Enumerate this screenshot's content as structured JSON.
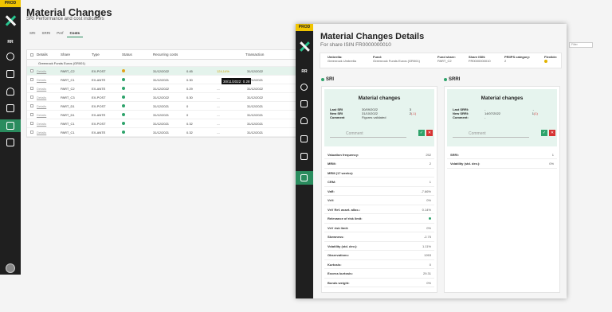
{
  "app": {
    "env_badge": "PROD",
    "user_initials": "RR",
    "logo": "x-logo"
  },
  "background": {
    "title": "Material Changes",
    "subtitle": "SRI Performance and cost indicators",
    "tabs": [
      "SRI",
      "SRRI",
      "Perf",
      "Costs"
    ],
    "active_tab": "Costs",
    "search_placeholder": "Filter",
    "table": {
      "columns": [
        "",
        "Details",
        "Share",
        "Type",
        "Status",
        "Recurring costs",
        "",
        "",
        "Transaction"
      ],
      "group_label": "Greenrock Funds Euros (GR001)",
      "rows": [
        {
          "details": "Details",
          "share": "PART_C2",
          "type": "EX-POST",
          "status_color": "#e2a21a",
          "date": "31/12/2022",
          "v1": "0.45",
          "v2": "124,14%",
          "tdate": "31/12/2022",
          "highlight": true
        },
        {
          "details": "Details",
          "share": "PART_C1",
          "type": "EX-ANTE",
          "status_color": "#2ea36b",
          "date": "31/12/2021",
          "v1": "0.30",
          "v2": "",
          "tdate": "31/12/2021",
          "highlight": false
        },
        {
          "details": "Details",
          "share": "PART_C2",
          "type": "EX-ANTE",
          "status_color": "#2ea36b",
          "date": "31/12/2022",
          "v1": "0.29",
          "v2": "—",
          "tdate": "31/12/2022",
          "highlight": false
        },
        {
          "details": "Details",
          "share": "PART_C3",
          "type": "EX-POST",
          "status_color": "#2ea36b",
          "date": "31/12/2022",
          "v1": "0.30",
          "v2": "—",
          "tdate": "31/12/2022",
          "highlight": false
        },
        {
          "details": "Details",
          "share": "PART_D1",
          "type": "EX-POST",
          "status_color": "#2ea36b",
          "date": "31/12/2021",
          "v1": "0",
          "v2": "—",
          "tdate": "31/12/2021",
          "highlight": false
        },
        {
          "details": "Details",
          "share": "PART_D1",
          "type": "EX-ANTE",
          "status_color": "#2ea36b",
          "date": "31/12/2021",
          "v1": "0",
          "v2": "—",
          "tdate": "31/12/2021",
          "highlight": false
        },
        {
          "details": "Details",
          "share": "PART_C1",
          "type": "EX-POST",
          "status_color": "#2ea36b",
          "date": "31/12/2021",
          "v1": "0.32",
          "v2": "—",
          "tdate": "31/12/2021",
          "highlight": false
        },
        {
          "details": "Details",
          "share": "PART_C1",
          "type": "EX-ANTE",
          "status_color": "#2ea36b",
          "date": "31/12/2021",
          "v1": "0.32",
          "v2": "—",
          "tdate": "31/12/2021",
          "highlight": false
        }
      ],
      "tooltip": "30/11/2022: 0.28"
    }
  },
  "panel": {
    "title": "Material Changes Details",
    "subtitle": "For share ISIN FR0000000010",
    "meta": [
      {
        "label": "Umbrella:",
        "value": "Greenrock Umbrella"
      },
      {
        "label": "Fund:",
        "value": "Greenrock Funds Euros (GR001)"
      },
      {
        "label": "Fund share:",
        "value": "PART_C2"
      },
      {
        "label": "Share ISIN:",
        "value": "FR0000000010"
      },
      {
        "label": "PRIIPS category:",
        "value": "2"
      },
      {
        "label": "Flexible:",
        "value": ""
      }
    ],
    "sri": {
      "heading": "SRI",
      "box_title": "Material changes",
      "rows": [
        {
          "k": "Last SRI",
          "v": "30/09/2022",
          "n": "3",
          "w": ""
        },
        {
          "k": "New SRI",
          "v": "31/10/2022",
          "n": "2",
          "w": "(-1)"
        },
        {
          "k": "Comment",
          "v": "Figures validated",
          "n": "",
          "w": ""
        }
      ],
      "comment_placeholder": "Comment",
      "indicators": [
        {
          "k": "Valuation frequency:",
          "v": "252"
        },
        {
          "k": "MRM:",
          "v": "2"
        },
        {
          "k": "MRM (17 weeks):",
          "v": ""
        },
        {
          "k": "CRM:",
          "v": "1"
        },
        {
          "k": "VaR:",
          "v": "-7.66%"
        },
        {
          "k": "VeV:",
          "v": "0%"
        },
        {
          "k": "VeV Ref. asset. alloc.:",
          "v": "0.14%"
        },
        {
          "k": "Relevance of risk limit:",
          "v": ""
        },
        {
          "k": "VeV risk limit:",
          "v": "0%"
        },
        {
          "k": "Skewness:",
          "v": "-2.75"
        },
        {
          "k": "Volatility (std. dev.):",
          "v": "1.11%"
        },
        {
          "k": "Observations:",
          "v": "1263"
        },
        {
          "k": "Kurtosis:",
          "v": "0"
        },
        {
          "k": "Excess kurtosis:",
          "v": "29.31"
        },
        {
          "k": "Bonds weight:",
          "v": "0%"
        }
      ]
    },
    "srri": {
      "heading": "SRRI",
      "box_title": "Material changes",
      "rows": [
        {
          "k": "Last SRRI:",
          "v": "-",
          "n": "-",
          "w": ""
        },
        {
          "k": "New SRRI:",
          "v": "14/07/2022",
          "n": "1",
          "w": "(1)"
        },
        {
          "k": "Comment:",
          "v": "-",
          "n": "",
          "w": ""
        }
      ],
      "comment_placeholder": "Comment",
      "indicators": [
        {
          "k": "SRRI:",
          "v": "1"
        },
        {
          "k": "Volatility (std. dev.):",
          "v": "0%"
        }
      ]
    }
  }
}
